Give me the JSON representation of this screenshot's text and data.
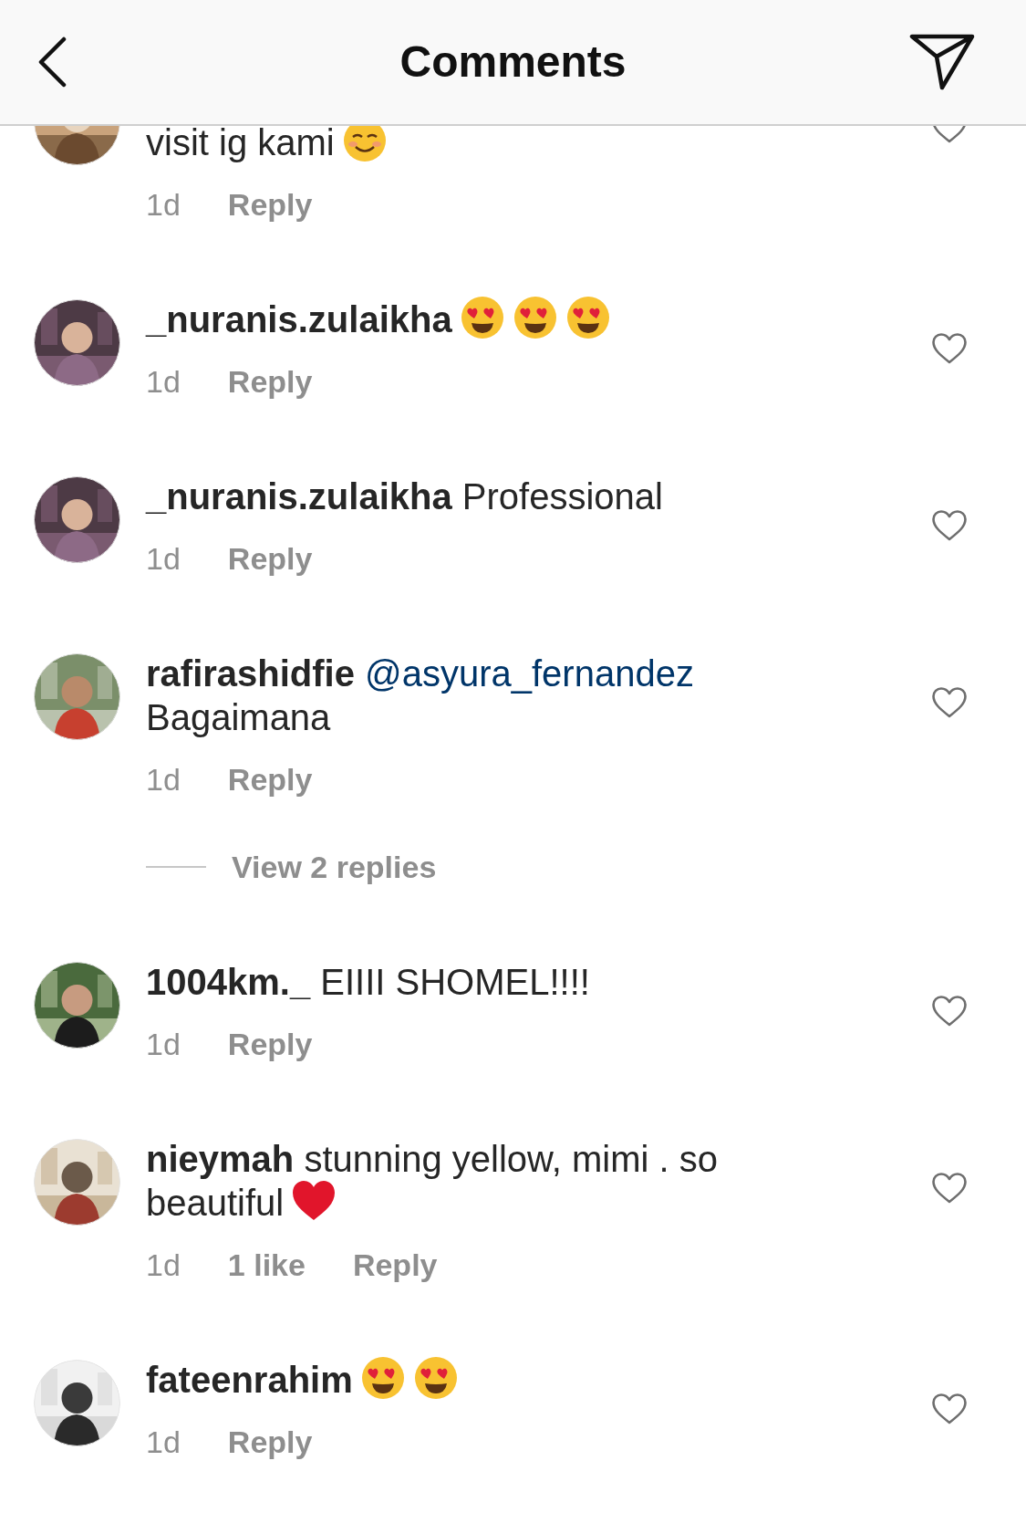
{
  "header": {
    "title": "Comments"
  },
  "comments": [
    {
      "text": "visit ig kami",
      "emojis": [
        {
          "kind": "smiling"
        }
      ],
      "time": "1d",
      "reply": "Reply",
      "liked": false
    },
    {
      "username": "_nuranis.zulaikha",
      "emojis": [
        {
          "kind": "heart_eyes"
        },
        {
          "kind": "heart_eyes"
        },
        {
          "kind": "heart_eyes"
        }
      ],
      "time": "1d",
      "reply": "Reply",
      "liked": false
    },
    {
      "username": "_nuranis.zulaikha",
      "text": "Professional",
      "time": "1d",
      "reply": "Reply",
      "liked": false
    },
    {
      "username": "rafirashidfie",
      "mention": "@asyura_fernandez",
      "text": "Bagaimana",
      "time": "1d",
      "reply": "Reply",
      "liked": false,
      "view_replies": "View 2 replies"
    },
    {
      "username": "1004km._",
      "text": "EIIII SHOMEL!!!!",
      "time": "1d",
      "reply": "Reply",
      "liked": false
    },
    {
      "username": "nieymah",
      "text": "stunning yellow, mimi . so beautiful",
      "emojis": [
        {
          "kind": "red_heart"
        }
      ],
      "time": "1d",
      "likes": "1 like",
      "reply": "Reply",
      "liked": false
    },
    {
      "username": "fateenrahim",
      "emojis": [
        {
          "kind": "heart_eyes"
        },
        {
          "kind": "heart_eyes"
        }
      ],
      "time": "1d",
      "reply": "Reply",
      "liked": false
    }
  ]
}
